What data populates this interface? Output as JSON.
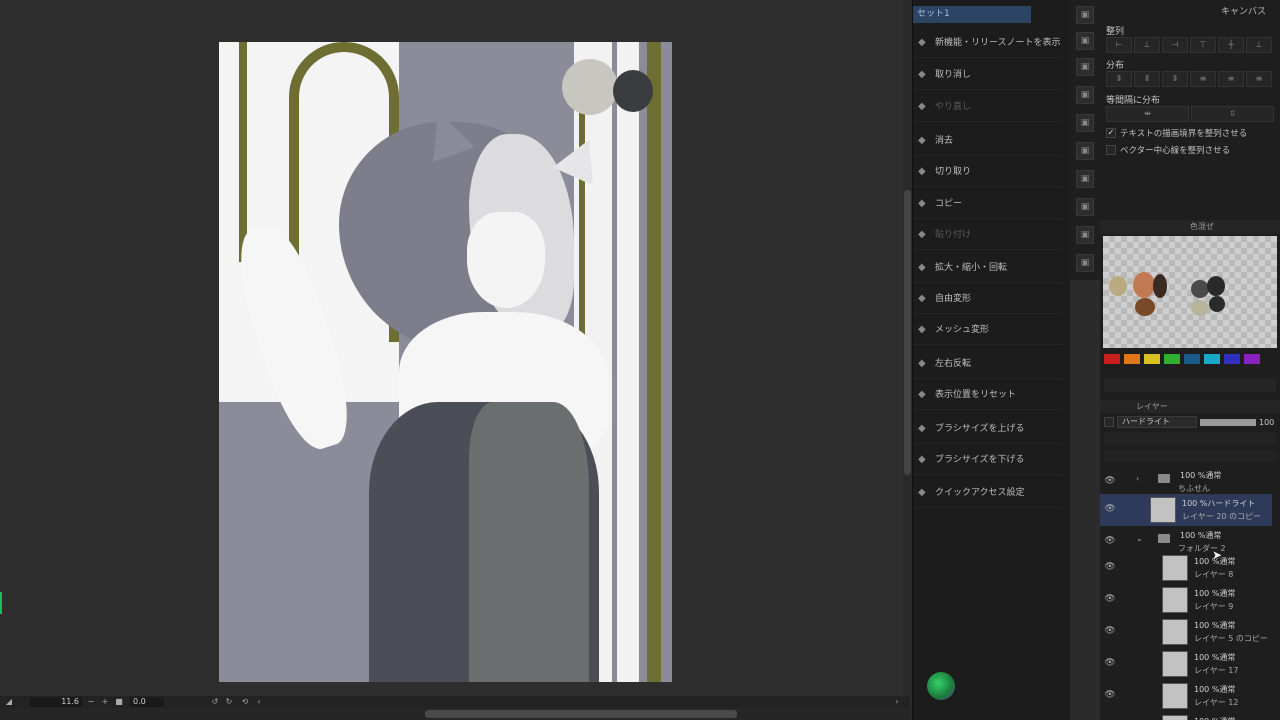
{
  "status_bar": {
    "zoom": "11.6",
    "rotation": "0.0"
  },
  "command_panel": {
    "header": "セット1",
    "items": [
      {
        "label": "新機能・リリースノートを表示",
        "icon": "info-icon",
        "enabled": true
      },
      {
        "label": "取り消し",
        "icon": "undo-icon",
        "enabled": true
      },
      {
        "label": "やり直し",
        "icon": "redo-icon",
        "enabled": false
      },
      {
        "label": "消去",
        "icon": "clear-icon",
        "enabled": true
      },
      {
        "label": "切り取り",
        "icon": "scissors-icon",
        "enabled": true
      },
      {
        "label": "コピー",
        "icon": "copy-icon",
        "enabled": true
      },
      {
        "label": "貼り付け",
        "icon": "paste-icon",
        "enabled": false
      },
      {
        "label": "拡大・縮小・回転",
        "icon": "transform-icon",
        "enabled": true
      },
      {
        "label": "自由変形",
        "icon": "free-transform-icon",
        "enabled": true
      },
      {
        "label": "メッシュ変形",
        "icon": "mesh-icon",
        "enabled": true
      },
      {
        "label": "左右反転",
        "icon": "flip-icon",
        "enabled": true
      },
      {
        "label": "表示位置をリセット",
        "icon": "reset-view-icon",
        "enabled": true
      },
      {
        "label": "ブラシサイズを上げる",
        "icon": "brush-up-icon",
        "enabled": true
      },
      {
        "label": "ブラシサイズを下げる",
        "icon": "brush-down-icon",
        "enabled": true
      },
      {
        "label": "クイックアクセス設定",
        "icon": "settings-icon",
        "enabled": true
      }
    ]
  },
  "right_panel": {
    "tab": "キャンバス",
    "align_label": "整列",
    "distribute_label": "分布",
    "equal_spacing_label": "等間隔に分布",
    "check_text_bounds": "テキストの描画境界を整列させる",
    "check_vector_center": "ベクター中心線を整列させる"
  },
  "color_panel": {
    "tab": "色混ぜ",
    "chips": [
      "#c81e1e",
      "#e07818",
      "#d8c020",
      "#30b030",
      "#1a5a8a",
      "#18a8c8",
      "#3030c0",
      "#8a20c0"
    ]
  },
  "layer_panel": {
    "tab": "レイヤー",
    "blend_mode": "ハードライト",
    "opacity": "100",
    "layers": [
      {
        "mode": "100 %通常",
        "name": "ちふせん",
        "type": "folder"
      },
      {
        "mode": "100 %ハードライト",
        "name": "レイヤー 20 のコピー",
        "type": "layer",
        "selected": true
      },
      {
        "mode": "100 %通常",
        "name": "フォルダー 2",
        "type": "folder"
      },
      {
        "mode": "100 %通常",
        "name": "レイヤー 8",
        "type": "layer"
      },
      {
        "mode": "100 %通常",
        "name": "レイヤー 9",
        "type": "layer"
      },
      {
        "mode": "100 %通常",
        "name": "レイヤー 5 のコピー",
        "type": "layer"
      },
      {
        "mode": "100 %通常",
        "name": "レイヤー 17",
        "type": "layer"
      },
      {
        "mode": "100 %通常",
        "name": "レイヤー 12",
        "type": "layer"
      },
      {
        "mode": "100 %通常",
        "name": "",
        "type": "layer"
      }
    ]
  }
}
